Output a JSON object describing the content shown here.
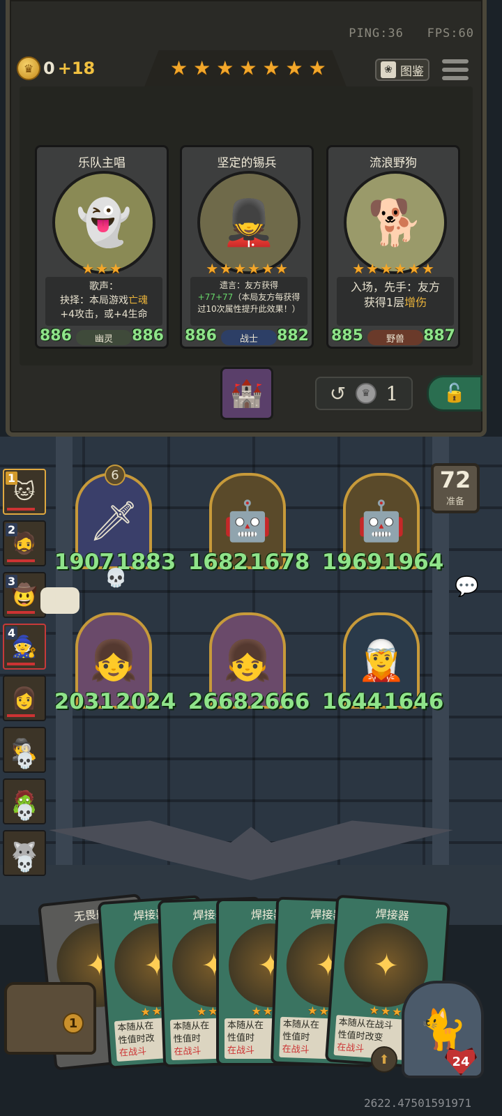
{
  "net": {
    "ping": "PING:36",
    "fps": "FPS:60"
  },
  "gold": {
    "amount": "0",
    "income": "+18"
  },
  "tier_stars": 7,
  "codex_label": "图鉴",
  "shop_cards": [
    {
      "name": "乐队主唱",
      "stars": 3,
      "atk": "886",
      "hp": "886",
      "tribe": "幽灵",
      "tribe_color": "#3f4a3a",
      "art": "👻",
      "art_bg": "#8a8a55",
      "desc_l1": "歌声：",
      "desc_l2a": "抉择：本局游戏",
      "desc_l2b": "亡魂",
      "desc_l3": "+4攻击，或+4生命"
    },
    {
      "name": "坚定的锡兵",
      "stars": 6,
      "atk": "886",
      "hp": "882",
      "tribe": "战士",
      "tribe_color": "#2d3f66",
      "art": "💂",
      "art_bg": "#6f6a4a",
      "desc_l1": "遗言：友方获得",
      "desc_l2a": "+77",
      "desc_l2b": "+77",
      "desc_l2c": "（本局友方每获得",
      "desc_l3": "过10次属性提升此效果！）"
    },
    {
      "name": "流浪野狗",
      "stars": 6,
      "atk": "885",
      "hp": "887",
      "tribe": "野兽",
      "tribe_color": "#6a3a2a",
      "art": "🐕",
      "art_bg": "#9a9a6a",
      "desc_l1": "入场，先手：友方",
      "desc_l2a": "获得1层",
      "desc_l2b": "增伤"
    }
  ],
  "refresh_cost": "1",
  "timer": {
    "value": "72",
    "label": "准备"
  },
  "players": [
    {
      "rank": "1",
      "avatar": "🐱",
      "state": "active"
    },
    {
      "rank": "2",
      "avatar": "🧔",
      "state": "alive"
    },
    {
      "rank": "3",
      "avatar": "🤠",
      "state": "alive"
    },
    {
      "rank": "4",
      "avatar": "🧙",
      "state": "self"
    },
    {
      "rank": "",
      "avatar": "👩",
      "state": "alive"
    },
    {
      "rank": "",
      "avatar": "🕵",
      "state": "dead"
    },
    {
      "rank": "",
      "avatar": "🧟",
      "state": "dead"
    },
    {
      "rank": "",
      "avatar": "🐺",
      "state": "dead"
    }
  ],
  "board": [
    {
      "atk": "1907",
      "hp": "1883",
      "art": "🗡",
      "bg": "#3a3f6a",
      "level": "6",
      "dead": true
    },
    {
      "atk": "1682",
      "hp": "1678",
      "art": "🤖",
      "bg": "#5a4a2a",
      "level": "",
      "dead": false
    },
    {
      "atk": "1969",
      "hp": "1964",
      "art": "🤖",
      "bg": "#5a4a2a",
      "level": "",
      "dead": false
    },
    {
      "atk": "2031",
      "hp": "2024",
      "art": "👧",
      "bg": "#6a4a6a",
      "level": "",
      "dead": false
    },
    {
      "atk": "2668",
      "hp": "2666",
      "art": "👧",
      "bg": "#6a4a6a",
      "level": "",
      "dead": false
    },
    {
      "atk": "1644",
      "hp": "1646",
      "art": "🧝",
      "bg": "#2a3a4a",
      "level": "",
      "dead": false
    }
  ],
  "hand": [
    {
      "name": "无畏船",
      "stars": 0,
      "line1": "",
      "line2": "",
      "line3": "",
      "style": "dark"
    },
    {
      "name": "焊接器",
      "stars": 3,
      "line1": "本随从在",
      "line2": "性值时改",
      "line3": "在战斗",
      "style": "green"
    },
    {
      "name": "焊接器",
      "stars": 3,
      "line1": "本随从在",
      "line2": "性值时",
      "line3": "在战斗",
      "style": "green"
    },
    {
      "name": "焊接器",
      "stars": 3,
      "line1": "本随从在",
      "line2": "性值时",
      "line3": "在战斗",
      "style": "green"
    },
    {
      "name": "焊接器",
      "stars": 3,
      "line1": "本随从在",
      "line2": "性值时",
      "line3": "在战斗",
      "style": "green"
    },
    {
      "name": "焊接器",
      "stars": 3,
      "line1": "本随从在战斗",
      "line2": "性值时改变",
      "line3": "在战斗",
      "style": "green"
    }
  ],
  "shop_level": "1",
  "player_health": "24",
  "coords": "2622.47501591971"
}
